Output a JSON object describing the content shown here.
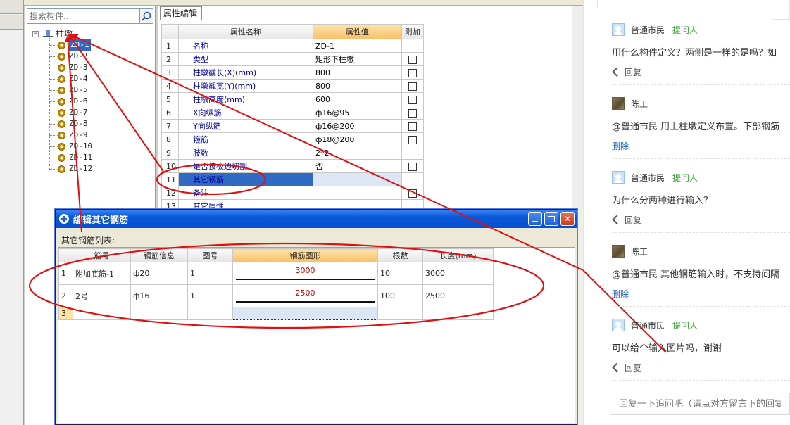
{
  "tree": {
    "search_placeholder": "搜索构件...",
    "root_label": "柱墩",
    "items": [
      "ZD-1",
      "ZD-2",
      "ZD-3",
      "ZD-4",
      "ZD-5",
      "ZD-6",
      "ZD-7",
      "ZD-8",
      "ZD-9",
      "ZD-10",
      "ZD-11",
      "ZD-12"
    ],
    "selected": "ZD-1"
  },
  "properties": {
    "tab_label": "属性编辑",
    "headers": {
      "name": "属性名称",
      "value": "属性值",
      "extra": "附加"
    },
    "rows": [
      {
        "num": "1",
        "name": "名称",
        "value": "ZD-1",
        "extra": false
      },
      {
        "num": "2",
        "name": "类型",
        "value": "矩形下柱墩",
        "extra": true
      },
      {
        "num": "3",
        "name": "柱墩截长(X)(mm)",
        "value": "800",
        "extra": true
      },
      {
        "num": "4",
        "name": "柱墩截宽(Y)(mm)",
        "value": "800",
        "extra": true
      },
      {
        "num": "5",
        "name": "柱墩高度(mm)",
        "value": "600",
        "extra": true
      },
      {
        "num": "6",
        "name": "X向纵筋",
        "value": "ф16@95",
        "extra": true
      },
      {
        "num": "7",
        "name": "Y向纵筋",
        "value": "ф16@200",
        "extra": true
      },
      {
        "num": "8",
        "name": "箍筋",
        "value": "ф18@200",
        "extra": true
      },
      {
        "num": "9",
        "name": "肢数",
        "value": "2*2",
        "extra": false
      },
      {
        "num": "10",
        "name": "是否按板边切割",
        "value": "否",
        "extra": true
      },
      {
        "num": "11",
        "name": "其它钢筋",
        "value": "",
        "extra": false
      },
      {
        "num": "12",
        "name": "备注",
        "value": "",
        "extra": true
      },
      {
        "num": "13",
        "name": "其它属性",
        "value": "",
        "extra": false
      }
    ]
  },
  "dialog": {
    "title": "编辑其它钢筋",
    "subtitle": "其它钢筋列表:",
    "headers": [
      "筋号",
      "钢筋信息",
      "图号",
      "钢筋图形",
      "根数",
      "长度(mm)"
    ],
    "rows": [
      {
        "num": "1",
        "bar_no": "附加底筋-1",
        "info": "ф20",
        "shape_no": "1",
        "shape_value": "3000",
        "count": "10",
        "length": "3000"
      },
      {
        "num": "2",
        "bar_no": "2号",
        "info": "ф16",
        "shape_no": "1",
        "shape_value": "2500",
        "count": "100",
        "length": "2500"
      }
    ],
    "empty_row_num": "3"
  },
  "comments": [
    {
      "author": "普通市民",
      "badge": "提问人",
      "text": "用什么构件定义？两侧是一样的是吗？如",
      "action": "回复",
      "avatar": "user-avatar"
    },
    {
      "author": "陈工",
      "badge": "",
      "text": "@普通市民  用上柱墩定义布置。下部钢筋",
      "action": "删除",
      "avatar": "expert-avatar"
    },
    {
      "author": "普通市民",
      "badge": "提问人",
      "text": "为什么分两种进行输入？",
      "action": "回复",
      "avatar": "user-avatar"
    },
    {
      "author": "陈工",
      "badge": "",
      "text": "@普通市民  其他钢筋输入时，不支持间隔",
      "action": "删除",
      "avatar": "expert-avatar"
    },
    {
      "author": "普通市民",
      "badge": "提问人",
      "text": "可以给个输入图片吗，谢谢",
      "action": "回复",
      "avatar": "user-avatar"
    }
  ],
  "reply_input": {
    "placeholder": "回复一下追问吧（请点对方留言下的回复"
  },
  "colors": {
    "annotation_red": "#e01010",
    "selection_blue": "#316ac5",
    "header_orange": "#f8c06a",
    "badge_green": "#3da03d",
    "link_blue": "#1a5fb4"
  }
}
